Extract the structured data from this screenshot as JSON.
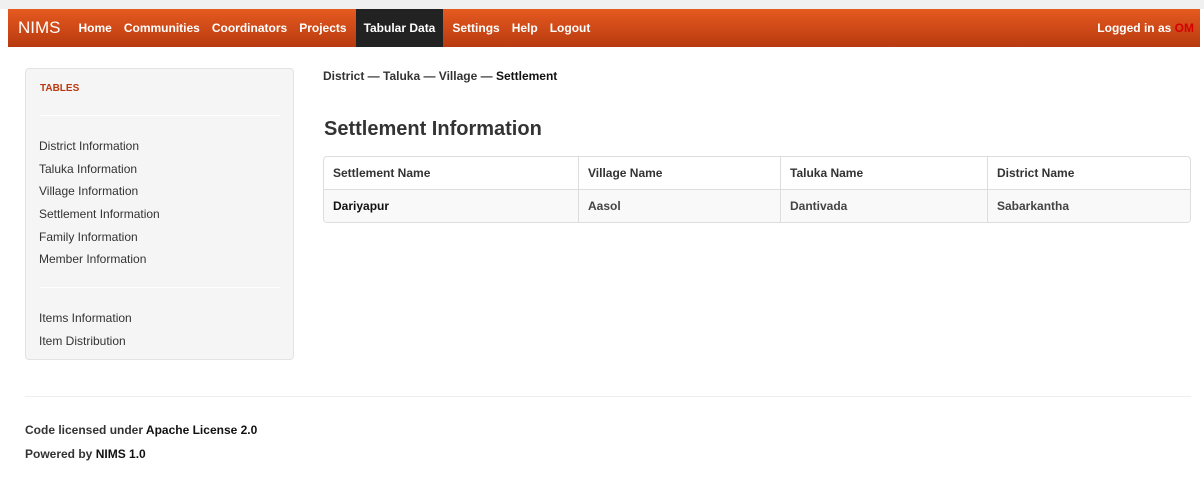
{
  "navbar": {
    "brand": "NIMS",
    "items": [
      {
        "label": "Home"
      },
      {
        "label": "Communities"
      },
      {
        "label": "Coordinators"
      },
      {
        "label": "Projects"
      },
      {
        "label": "Tabular Data",
        "active": true
      },
      {
        "label": "Settings"
      },
      {
        "label": "Help"
      },
      {
        "label": "Logout"
      }
    ],
    "login_prefix": "Logged in as",
    "login_user": "OM"
  },
  "sidebar": {
    "header": "TABLES",
    "group1": [
      "District Information",
      "Taluka Information",
      "Village Information",
      "Settlement Information",
      "Family Information",
      "Member Information"
    ],
    "group2": [
      "Items Information",
      "Item Distribution"
    ]
  },
  "breadcrumb": {
    "path": "District — Taluka — Village — ",
    "current": "Settlement"
  },
  "main": {
    "title": "Settlement Information",
    "table": {
      "headers": [
        "Settlement Name",
        "Village Name",
        "Taluka Name",
        "District Name"
      ],
      "rows": [
        [
          "Dariyapur",
          "Aasol",
          "Dantivada",
          "Sabarkantha"
        ]
      ]
    }
  },
  "footer": {
    "line1_prefix": "Code licensed under",
    "line1_link": "Apache License 2.0",
    "line2_prefix": "Powered by",
    "line2_link": "NIMS 1.0"
  },
  "colors": {
    "navbar_top": "#e55a1f",
    "navbar_bottom": "#b83a10",
    "active_nav": "#222222",
    "sidebar_header": "#b83a10",
    "login_user": "#d40000"
  }
}
